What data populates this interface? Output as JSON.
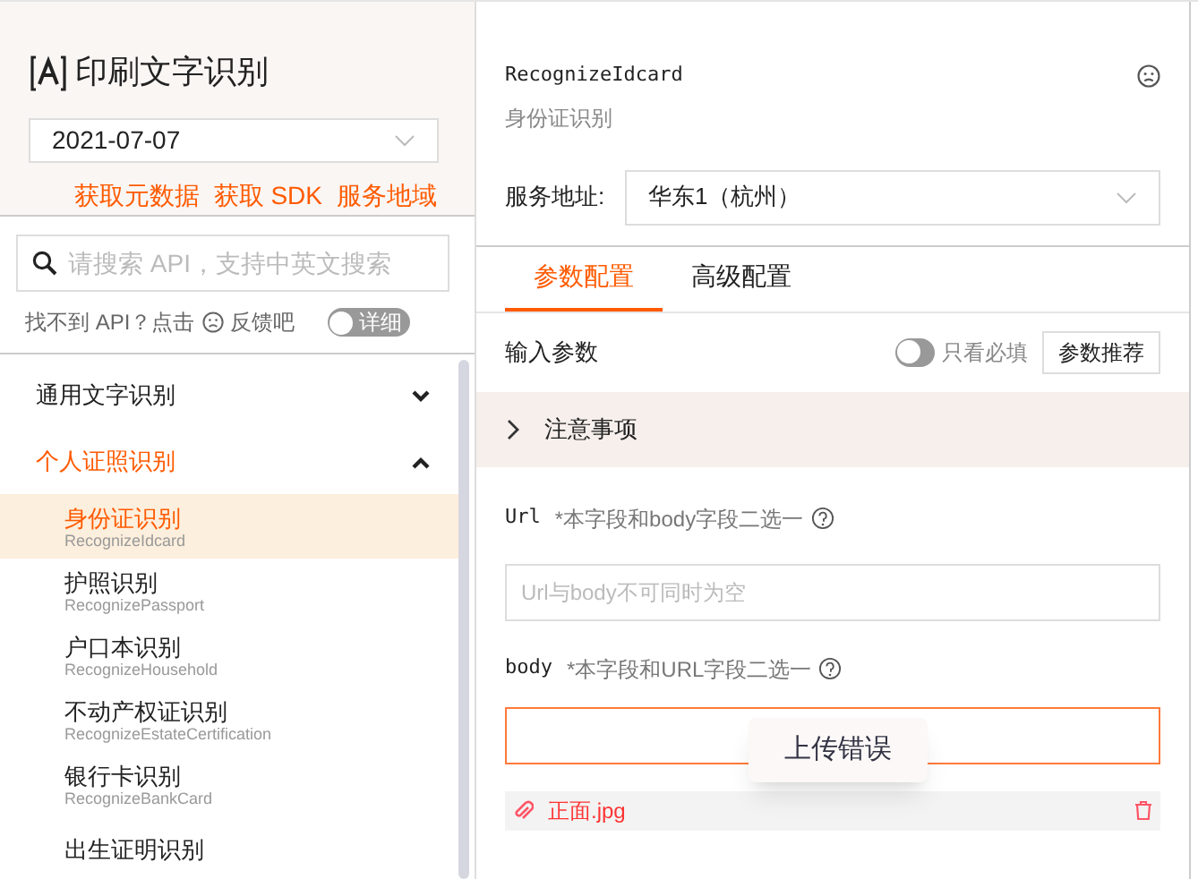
{
  "product": {
    "title": "印刷文字识别"
  },
  "version": {
    "value": "2021-07-07"
  },
  "links": [
    "获取元数据",
    "获取 SDK",
    "服务地域"
  ],
  "search": {
    "placeholder": "请搜索 API，支持中英文搜索"
  },
  "feedback": {
    "before": "找不到 API？点击",
    "after": "反馈吧",
    "toggle_label": "详细",
    "on": false
  },
  "groups": [
    {
      "label": "通用文字识别",
      "expanded": false
    },
    {
      "label": "个人证照识别",
      "expanded": true,
      "items": [
        {
          "name": "身份证识别",
          "api": "RecognizeIdcard",
          "selected": true
        },
        {
          "name": "护照识别",
          "api": "RecognizePassport",
          "selected": false
        },
        {
          "name": "户口本识别",
          "api": "RecognizeHousehold",
          "selected": false
        },
        {
          "name": "不动产权证识别",
          "api": "RecognizeEstateCertification",
          "selected": false
        },
        {
          "name": "银行卡识别",
          "api": "RecognizeBankCard",
          "selected": false
        },
        {
          "name": "出生证明识别",
          "selected": false
        }
      ]
    }
  ],
  "api": {
    "name": "RecognizeIdcard",
    "subtitle": "身份证识别"
  },
  "endpoint": {
    "label": "服务地址:",
    "value": "华东1（杭州）"
  },
  "tabs": [
    {
      "label": "参数配置",
      "selected": true
    },
    {
      "label": "高级配置",
      "selected": false
    }
  ],
  "params": {
    "title": "输入参数",
    "required_only": {
      "label": "只看必填",
      "on": false
    },
    "recommend": "参数推荐"
  },
  "notice": {
    "label": "注意事项",
    "expanded": false
  },
  "fields": [
    {
      "name": "Url",
      "note": "*本字段和body字段二选一",
      "placeholder": "Url与body不可同时为空",
      "kind": "text"
    },
    {
      "name": "body",
      "note": "*本字段和URL字段二选一",
      "kind": "upload",
      "error": true,
      "file": "正面.jpg"
    }
  ],
  "tooltip": "上传错误"
}
